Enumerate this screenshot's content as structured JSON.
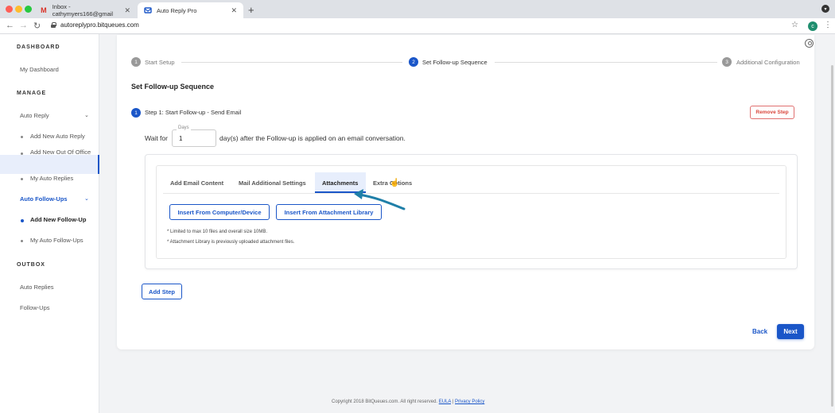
{
  "browser": {
    "tabs": [
      {
        "title": "Inbox - cathymyers166@gmail",
        "icon": "gmail-icon"
      },
      {
        "title": "Auto Reply Pro",
        "icon": "app-icon"
      }
    ],
    "url": "autoreplypro.bitqueues.com",
    "profile_initial": "c"
  },
  "sidebar": {
    "dashboard_section": "DASHBOARD",
    "my_dashboard": "My Dashboard",
    "manage_section": "MANAGE",
    "auto_reply": "Auto Reply",
    "add_new_auto_reply": "Add New Auto Reply",
    "add_new_out_of_office": "Add New Out Of Office",
    "my_auto_replies": "My Auto Replies",
    "auto_follow_ups": "Auto Follow-Ups",
    "add_new_follow_up": "Add New Follow-Up",
    "my_auto_follow_ups": "My Auto Follow-Ups",
    "outbox_section": "OUTBOX",
    "auto_replies": "Auto Replies",
    "follow_ups": "Follow-Ups"
  },
  "stepper": {
    "steps": [
      {
        "num": "1",
        "label": "Start Setup",
        "state": "done"
      },
      {
        "num": "2",
        "label": "Set Follow-up Sequence",
        "state": "active"
      },
      {
        "num": "3",
        "label": "Additional Configuration",
        "state": "pending"
      }
    ]
  },
  "form": {
    "heading": "Set Follow-up Sequence",
    "step_num": "1",
    "step_title": "Step 1: Start Follow-up - Send Email",
    "remove_step": "Remove Step",
    "wait_for": "Wait for",
    "days_label": "Days",
    "days_value": "1",
    "after_text": "day(s) after the Follow-up is applied on an email conversation."
  },
  "tabs": {
    "items": [
      "Add Email Content",
      "Mail Additional Settings",
      "Attachments",
      "Extra Options"
    ],
    "active": "Attachments"
  },
  "attachments": {
    "insert_computer": "Insert From Computer/Device",
    "insert_library": "Insert From Attachment Library",
    "note1": "* Limited to max 10 files and overall size 10MB.",
    "note2": "* Attachment Library is previously uploaded attachment files."
  },
  "actions": {
    "add_step": "Add Step",
    "back": "Back",
    "next": "Next"
  },
  "footer": {
    "copyright": "Copyright 2018 BitQueues.com. All right reserved.",
    "eula": "EULA",
    "separator": "|",
    "privacy": "Privacy Policy"
  },
  "colors": {
    "accent": "#1a56c8",
    "danger": "#d9443a",
    "annotation_arrow": "#1f7fa8"
  }
}
